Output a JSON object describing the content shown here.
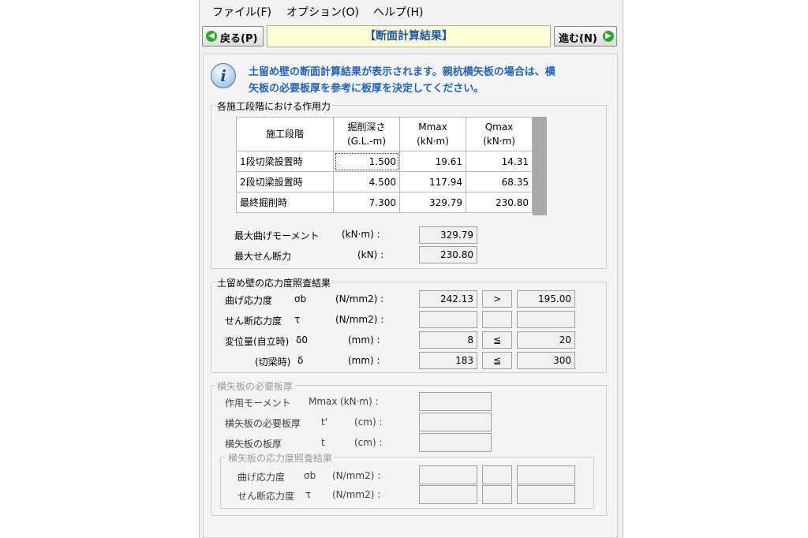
{
  "menu": {
    "file": "ファイル(F)",
    "options": "オプション(O)",
    "help": "ヘルプ(H)"
  },
  "nav": {
    "back": "戻る(P)",
    "title": "【断面計算結果】",
    "next": "進む(N)"
  },
  "info": {
    "line1": "土留め壁の断面計算結果が表示されます。親杭横矢板の場合は、横",
    "line2": "矢板の必要板厚を参考に板厚を決定してください。"
  },
  "stage_forces": {
    "title": "各施工段階における作用力",
    "headers": [
      {
        "l1": "施工段階",
        "l2": ""
      },
      {
        "l1": "掘削深さ",
        "l2": "(G.L.-m)"
      },
      {
        "l1": "Mmax",
        "l2": "(kN·m)"
      },
      {
        "l1": "Qmax",
        "l2": "(kN·m)"
      }
    ],
    "rows": [
      {
        "stage": "1段切梁設置時",
        "depth": "1.500",
        "mmax": "19.61",
        "qmax": "14.31"
      },
      {
        "stage": "2段切梁設置時",
        "depth": "4.500",
        "mmax": "117.94",
        "qmax": "68.35"
      },
      {
        "stage": "最終掘削時",
        "depth": "7.300",
        "mmax": "329.79",
        "qmax": "230.80"
      }
    ],
    "max_moment_label": "最大曲げモーメント",
    "max_moment_unit": "(kN·m) :",
    "max_moment_value": "329.79",
    "max_shear_label": "最大せん断力",
    "max_shear_unit": "(kN) :",
    "max_shear_value": "230.80"
  },
  "wall_check": {
    "title": "土留め壁の応力度照査結果",
    "rows": [
      {
        "label": "曲げ応力度",
        "sym": "σb",
        "unit": "(N/mm2) :",
        "value": "242.13",
        "op": ">",
        "limit": "195.00"
      },
      {
        "label": "せん断応力度",
        "sym": "τ",
        "unit": "(N/mm2) :",
        "value": "",
        "op": "",
        "limit": ""
      },
      {
        "label": "変位量(自立時)",
        "sym": "δ0",
        "unit": "(mm) :",
        "value": "8",
        "op": "≦",
        "limit": "20"
      },
      {
        "label": "(切梁時)",
        "sym": "δ",
        "unit": "(mm) :",
        "value": "183",
        "op": "≦",
        "limit": "300"
      }
    ]
  },
  "lagging": {
    "title": "横矢板の必要板厚",
    "rows": [
      {
        "label": "作用モーメント",
        "sym": "Mmax",
        "unit": "(kN·m) :",
        "value": ""
      },
      {
        "label": "横矢板の必要板厚",
        "sym": "t'",
        "unit": "(cm) :",
        "value": ""
      },
      {
        "label": "横矢板の板厚",
        "sym": "t",
        "unit": "(cm) :",
        "value": ""
      }
    ],
    "check_title": "横矢板の応力度照査結果",
    "check_rows": [
      {
        "label": "曲げ応力度",
        "sym": "σb",
        "unit": "(N/mm2) :",
        "value": "",
        "op": "",
        "limit": ""
      },
      {
        "label": "せん断応力度",
        "sym": "τ",
        "unit": "(N/mm2) :",
        "value": "",
        "op": "",
        "limit": ""
      }
    ]
  }
}
